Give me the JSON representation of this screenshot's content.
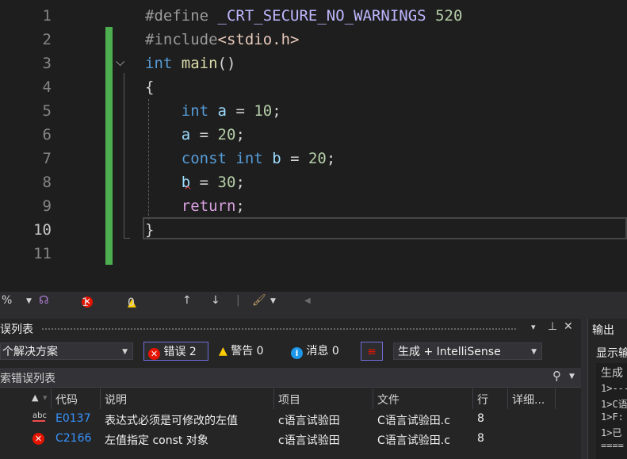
{
  "editor": {
    "line_numbers": [
      "1",
      "2",
      "3",
      "4",
      "5",
      "6",
      "7",
      "8",
      "9",
      "10",
      "11"
    ],
    "lines": [
      [
        {
          "t": "#define ",
          "c": "pp"
        },
        {
          "t": "_CRT_SECURE_NO_WARNINGS",
          "c": "macro"
        },
        {
          "t": " 520",
          "c": "num"
        }
      ],
      [
        {
          "t": "#include",
          "c": "pp"
        },
        {
          "t": "<stdio.h>",
          "c": "str"
        }
      ],
      [
        {
          "t": "int",
          "c": "kw"
        },
        {
          "t": " ",
          "c": "pn"
        },
        {
          "t": "main",
          "c": "fn"
        },
        {
          "t": "()",
          "c": "pn"
        }
      ],
      [
        {
          "t": "{",
          "c": "pn"
        }
      ],
      [
        {
          "t": "    ",
          "c": "pn"
        },
        {
          "t": "int",
          "c": "kw"
        },
        {
          "t": " ",
          "c": "pn"
        },
        {
          "t": "a",
          "c": "var"
        },
        {
          "t": " = ",
          "c": "pn"
        },
        {
          "t": "10",
          "c": "num"
        },
        {
          "t": ";",
          "c": "pn"
        }
      ],
      [
        {
          "t": "    ",
          "c": "pn"
        },
        {
          "t": "a",
          "c": "var"
        },
        {
          "t": " = ",
          "c": "pn"
        },
        {
          "t": "20",
          "c": "num"
        },
        {
          "t": ";",
          "c": "pn"
        }
      ],
      [
        {
          "t": "    ",
          "c": "pn"
        },
        {
          "t": "const",
          "c": "kw"
        },
        {
          "t": " ",
          "c": "pn"
        },
        {
          "t": "int",
          "c": "kw"
        },
        {
          "t": " ",
          "c": "pn"
        },
        {
          "t": "b",
          "c": "var"
        },
        {
          "t": " = ",
          "c": "pn"
        },
        {
          "t": "20",
          "c": "num"
        },
        {
          "t": ";",
          "c": "pn"
        }
      ],
      [
        {
          "t": "    ",
          "c": "pn"
        },
        {
          "t": "b",
          "c": "var"
        },
        {
          "t": " = ",
          "c": "pn"
        },
        {
          "t": "30",
          "c": "num"
        },
        {
          "t": ";",
          "c": "pn"
        }
      ],
      [
        {
          "t": "    ",
          "c": "pn"
        },
        {
          "t": "return",
          "c": "ctl"
        },
        {
          "t": ";",
          "c": "pn"
        }
      ],
      [
        {
          "t": "}",
          "c": "pn"
        }
      ],
      []
    ],
    "current_line": "10"
  },
  "editor_status": {
    "zoom": "%",
    "error_count": "1",
    "warning_count": "0",
    "up_arrow": "↑",
    "down_arrow": "↓"
  },
  "error_list": {
    "title": "误列表",
    "pin": "▾",
    "dock": "ᚹ",
    "close": "✕",
    "scope_value": "个解决方案",
    "errors_label": "错误 2",
    "warnings_label": "警告 0",
    "messages_label": "消息 0",
    "build_filter": "生成 + IntelliSense",
    "search_placeholder": "索错误列表",
    "columns": {
      "code": "代码",
      "description": "说明",
      "project": "项目",
      "file": "文件",
      "line": "行",
      "details": "详细..."
    },
    "rows": [
      {
        "icon": "abc",
        "code": "E0137",
        "description": "表达式必须是可修改的左值",
        "project": "c语言试验田",
        "file": "C语言试验田.c",
        "line": "8"
      },
      {
        "icon": "error",
        "code": "C2166",
        "description": "左值指定 const 对象",
        "project": "c语言试验田",
        "file": "C语言试验田.c",
        "line": "8"
      }
    ]
  },
  "output": {
    "title": "输出",
    "show_label": "显示输",
    "lines": [
      "生成",
      "1>---",
      "1>C语",
      "1>F:",
      "1>已",
      "===="
    ]
  }
}
